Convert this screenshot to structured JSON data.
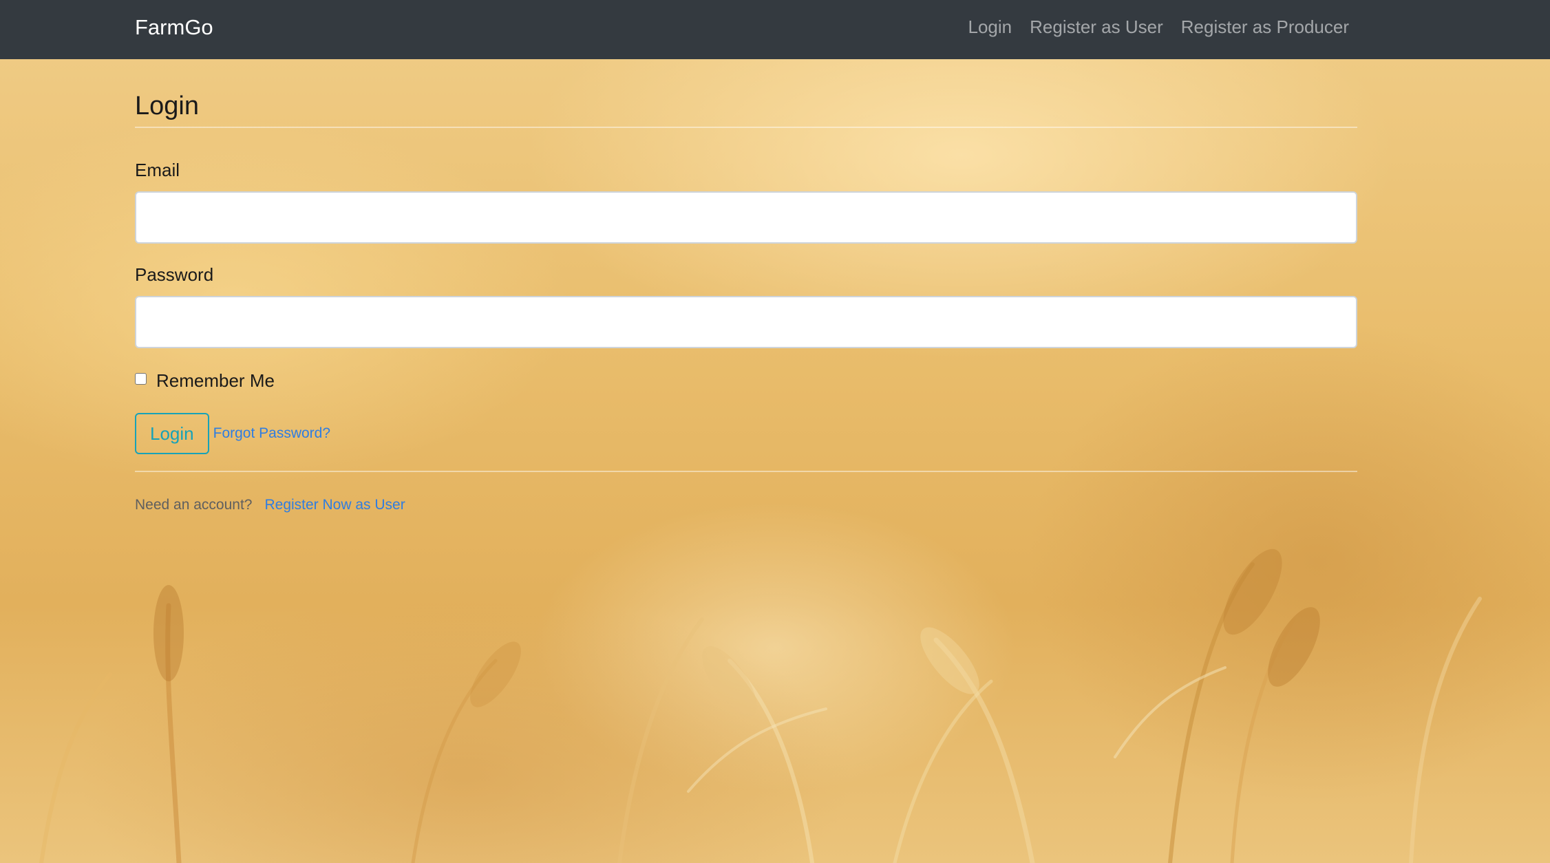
{
  "navbar": {
    "brand": "FarmGo",
    "links": [
      {
        "label": "Login"
      },
      {
        "label": "Register as User"
      },
      {
        "label": "Register as Producer"
      }
    ]
  },
  "form": {
    "legend": "Login",
    "email_label": "Email",
    "email_value": "",
    "password_label": "Password",
    "password_value": "",
    "remember_label": "Remember Me",
    "remember_checked": false,
    "submit_label": "Login",
    "forgot_label": "Forgot Password?"
  },
  "footer": {
    "prompt": "Need an account?",
    "register_label": "Register Now as User"
  },
  "colors": {
    "navbar_bg": "#343a40",
    "button_outline": "#17a2b8",
    "link": "#2f7de1"
  }
}
